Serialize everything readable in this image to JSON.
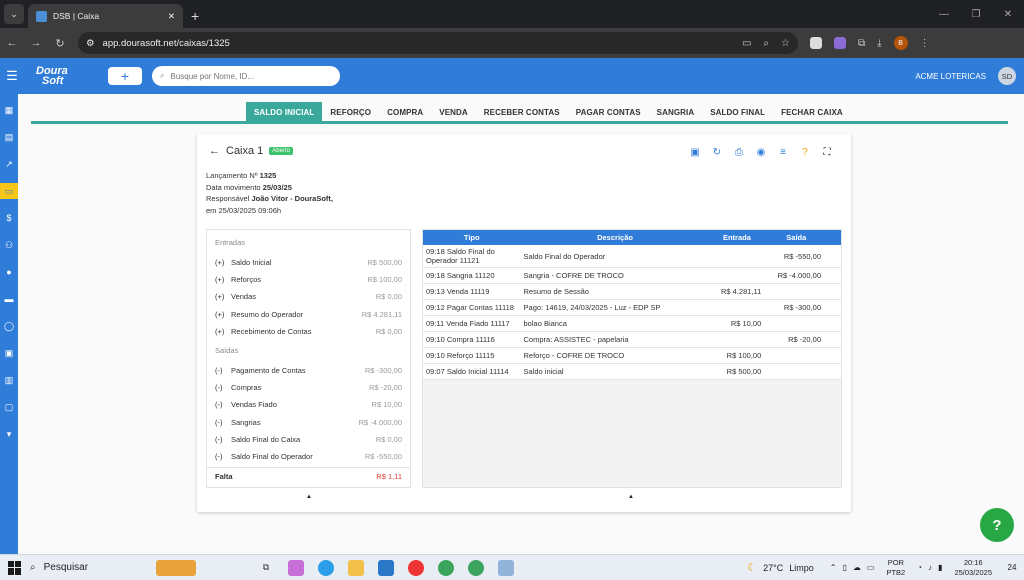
{
  "browser": {
    "tab_title": "DSB | Caixa",
    "url": "app.dourasoft.net/caixas/1325",
    "profile_initial": "B"
  },
  "header": {
    "logo_line1": "Doura",
    "logo_line2": "Soft",
    "add_label": "+",
    "search_placeholder": "Busque por Nome, ID...",
    "org_name": "ACME LOTERICAS",
    "user_initials": "SD"
  },
  "tabs": [
    {
      "label": "SALDO INICIAL",
      "active": true
    },
    {
      "label": "REFORÇO"
    },
    {
      "label": "COMPRA"
    },
    {
      "label": "VENDA"
    },
    {
      "label": "RECEBER CONTAS"
    },
    {
      "label": "PAGAR CONTAS"
    },
    {
      "label": "SANGRIA"
    },
    {
      "label": "SALDO FINAL"
    },
    {
      "label": "FECHAR CAIXA"
    }
  ],
  "caixa": {
    "title": "Caixa 1",
    "status": "Aberto",
    "lancamento_label": "Lançamento Nº",
    "lancamento": "1325",
    "data_label": "Data movimento",
    "data": "25/03/25",
    "resp_label": "Responsável",
    "responsavel": "João Vitor - DouraSoft,",
    "em": "em 25/03/2025 09:06h"
  },
  "summary": {
    "entradas_title": "Entradas",
    "entradas": [
      {
        "sign": "(+)",
        "label": "Saldo Inicial",
        "value": "R$ 500,00"
      },
      {
        "sign": "(+)",
        "label": "Reforços",
        "value": "R$ 100,00"
      },
      {
        "sign": "(+)",
        "label": "Vendas",
        "value": "R$ 0,00"
      },
      {
        "sign": "(+)",
        "label": "Resumo do Operador",
        "value": "R$ 4.281,11"
      },
      {
        "sign": "(+)",
        "label": "Recebimento de Contas",
        "value": "R$ 0,00"
      }
    ],
    "saidas_title": "Saídas",
    "saidas": [
      {
        "sign": "(-)",
        "label": "Pagamento de Contas",
        "value": "R$ -300,00"
      },
      {
        "sign": "(-)",
        "label": "Compras",
        "value": "R$ -20,00"
      },
      {
        "sign": "(-)",
        "label": "Vendas Fiado",
        "value": "R$ 10,00"
      },
      {
        "sign": "(-)",
        "label": "Sangrias",
        "value": "R$ -4.000,00"
      },
      {
        "sign": "(-)",
        "label": "Saldo Final do Caixa",
        "value": "R$ 0,00"
      },
      {
        "sign": "(-)",
        "label": "Saldo Final do Operador",
        "value": "R$ -550,00"
      }
    ],
    "falta_label": "Falta",
    "falta_value": "R$ 1,11"
  },
  "table": {
    "headers": [
      "Tipo",
      "Descrição",
      "Entrada",
      "Saída"
    ],
    "rows": [
      [
        "09:18 Saldo Final do Operador 11121",
        "Saldo Final do Operador",
        "",
        "R$ -550,00"
      ],
      [
        "09:18 Sangria 11120",
        "Sangria - COFRE DE TROCO",
        "",
        "R$ -4.000,00"
      ],
      [
        "09:13 Venda 11119",
        "Resumo de Sessão",
        "R$ 4.281,11",
        ""
      ],
      [
        "09:12 Pagar Contas 11118",
        "Pago: 14619, 24/03/2025 - Luz - EDP SP",
        "",
        "R$ -300,00"
      ],
      [
        "09:11 Venda Fiado 11117",
        "bolao Bianca",
        "R$ 10,00",
        ""
      ],
      [
        "09:10 Compra 11116",
        "Compra: ASSISTEC - papelaria",
        "",
        "R$ -20,00"
      ],
      [
        "09:10 Reforço 11115",
        "Reforço - COFRE DE TROCO",
        "R$ 100,00",
        ""
      ],
      [
        "09:07 Saldo Inicial 11114",
        "Saldo inicial",
        "R$ 500,00",
        ""
      ]
    ]
  },
  "fab_label": "?",
  "taskbar": {
    "search_label": "Pesquisar",
    "weather_temp": "27°C",
    "weather_desc": "Limpo",
    "lang1": "POR",
    "lang2": "PTB2",
    "time": "20:16",
    "date": "25/03/2025",
    "notif_count": "24"
  }
}
